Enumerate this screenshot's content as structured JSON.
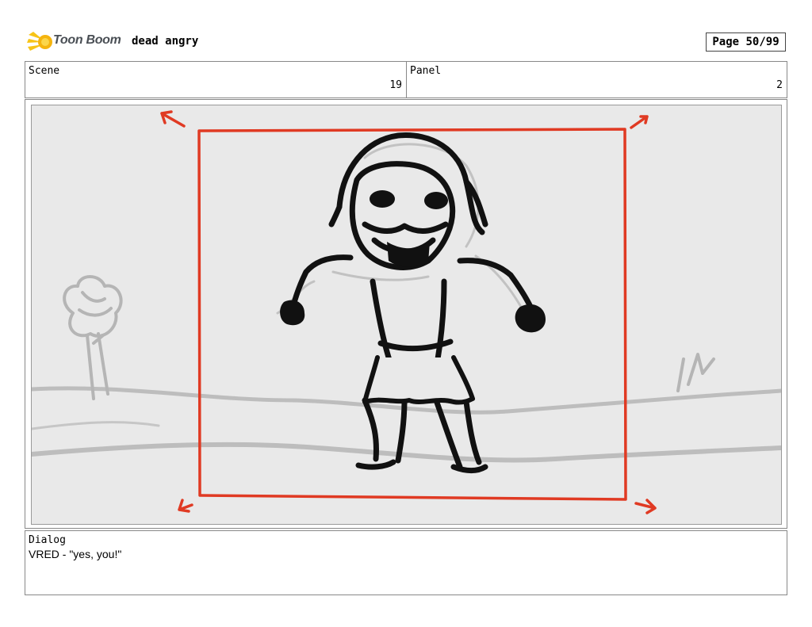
{
  "header": {
    "logo_text": "Toon Boom",
    "project_title": "dead angry",
    "page_label": "Page 50/99"
  },
  "info": {
    "scene_label": "Scene",
    "scene_value": "19",
    "panel_label": "Panel",
    "panel_value": "2"
  },
  "dialog": {
    "label": "Dialog",
    "text": "VRED  - \"yes, you!\""
  },
  "colors": {
    "camera_frame": "#e03a23",
    "sketch_background": "#e9e9e9",
    "logo_yellow": "#f7c417"
  }
}
